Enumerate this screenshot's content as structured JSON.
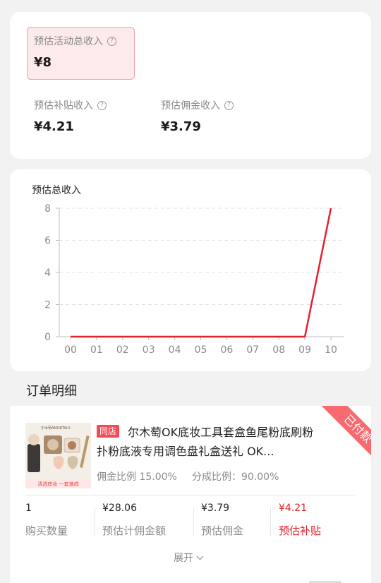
{
  "summary": {
    "total_label": "预估活动总收入",
    "total_value": "¥8",
    "subsidy_label": "预估补贴收入",
    "subsidy_value": "¥4.21",
    "commission_label": "预估佣金收入",
    "commission_value": "¥3.79"
  },
  "chart_data": {
    "type": "line",
    "title": "预估总收入",
    "xlabel": "",
    "ylabel": "",
    "categories": [
      "00",
      "01",
      "02",
      "03",
      "04",
      "05",
      "06",
      "07",
      "08",
      "09",
      "10"
    ],
    "series": [
      {
        "values": [
          0,
          0,
          0,
          0,
          0,
          0,
          0,
          0,
          0,
          0,
          8
        ]
      }
    ],
    "ylim": [
      0,
      8
    ],
    "yticks": [
      "0",
      "2",
      "4",
      "6",
      "8"
    ],
    "grid": true,
    "line_color": "#e5212d"
  },
  "orders": {
    "section_title": "订单明细",
    "item": {
      "image_brand": "尔木萄AMORTALS",
      "image_caption": "清透底妆 一套速成",
      "tag": "同店",
      "title": "尔木萄OK底妆工具套盒鱼尾粉底刷粉扑粉底液专用调色盘礼盒送礼 OK...",
      "status": "已付款",
      "commission_ratio": "佣金比例 15.00%",
      "share_ratio": "分成比例：90.00%",
      "columns": [
        {
          "value": "1",
          "label": "购买数量"
        },
        {
          "value": "¥28.06",
          "label": "预估计佣金额"
        },
        {
          "value": "¥3.79",
          "label": "预估佣金"
        },
        {
          "value": "¥4.21",
          "label": "预估补贴"
        }
      ],
      "expand_label": "展开"
    }
  },
  "colors": {
    "accent": "#e5212d",
    "ribbon": "#f56b6f",
    "tag": "#f24b55"
  }
}
